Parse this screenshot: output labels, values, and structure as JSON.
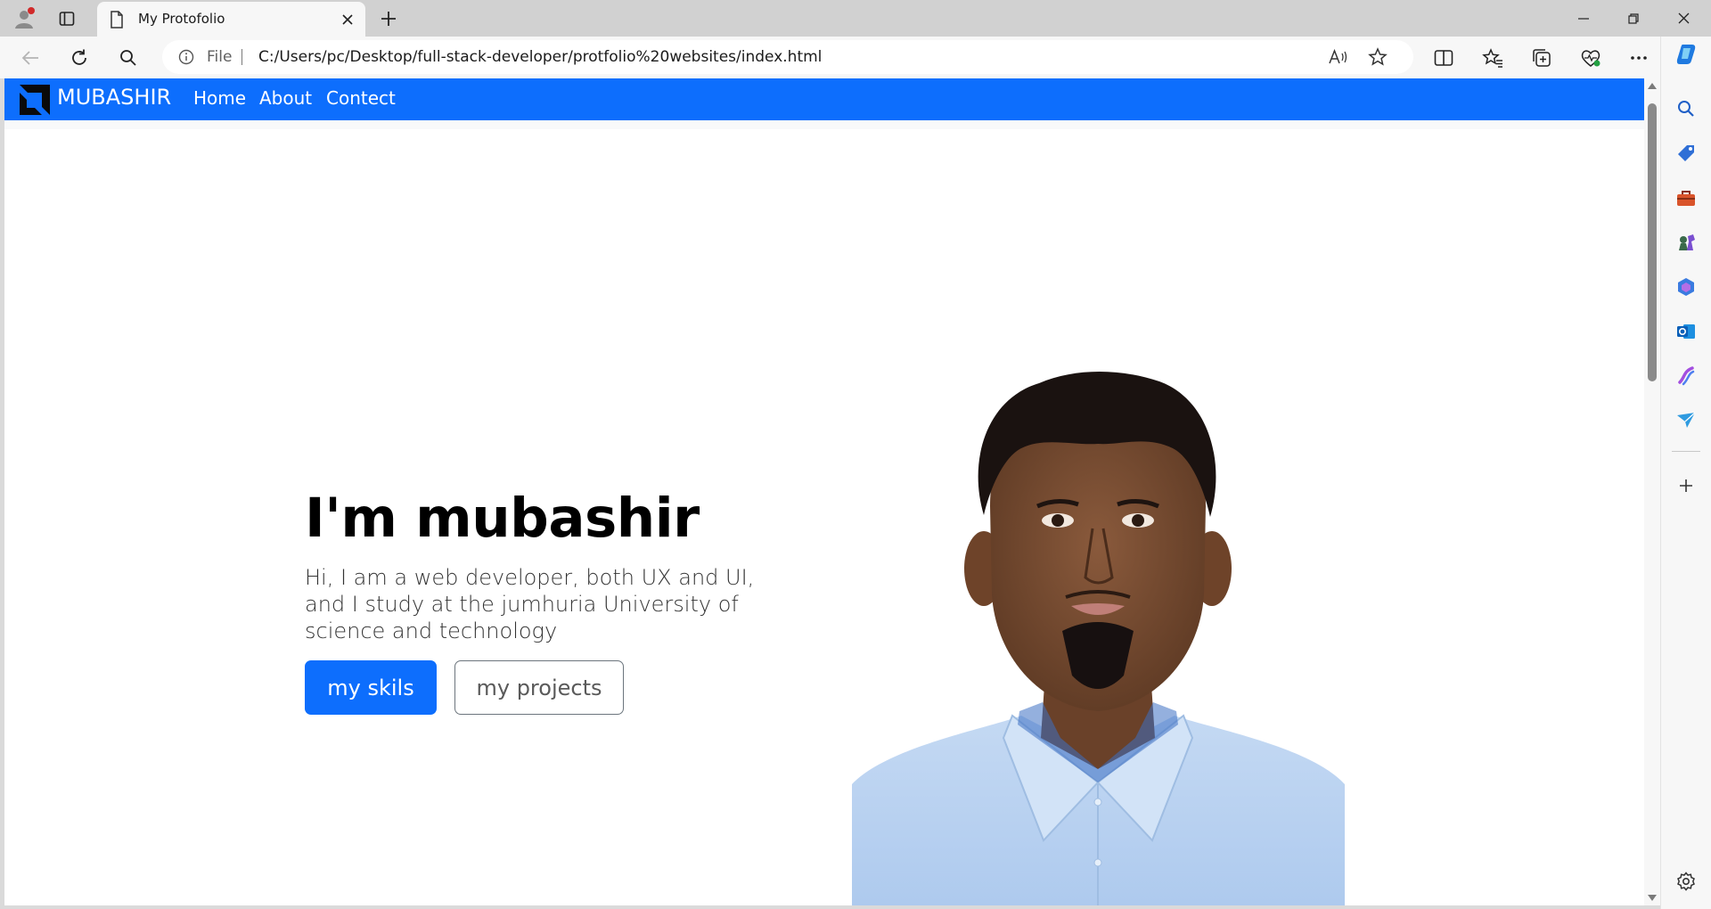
{
  "browser": {
    "tab": {
      "title": "My Protofolio"
    },
    "address_bar": {
      "scheme_label": "File",
      "url": "C:/Users/pc/Desktop/full-stack-developer/protfolio%20websites/index.html"
    }
  },
  "navbar": {
    "brand": "MUBASHIR",
    "links": [
      "Home",
      "About",
      "Contect"
    ]
  },
  "hero": {
    "title": "I'm mubashir",
    "text": "Hi, I am a web developer, both UX and UI, and I study at the jumhuria University of science and technology",
    "primary_button": "my skils",
    "secondary_button": "my projects"
  },
  "colors": {
    "accent": "#0d6efd",
    "sidebar_copilot": "#1f7ae0"
  },
  "icons": {
    "sidebar": [
      "search-icon",
      "tag-icon",
      "toolbox-icon",
      "chess-icon",
      "copilot-m365-icon",
      "outlook-icon",
      "drop-icon",
      "send-icon",
      "add-icon",
      "settings-icon"
    ]
  }
}
